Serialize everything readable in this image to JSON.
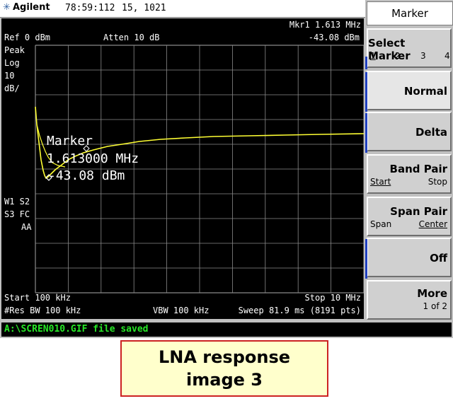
{
  "header": {
    "brand": "Agilent",
    "time": "78:59:112",
    "date": "15, 1021"
  },
  "display": {
    "ref": "Ref 0 dBm",
    "atten": "Atten 10 dB",
    "marker_readout_line1": "Mkr1  1.613 MHz",
    "marker_readout_line2": "-43.08 dBm",
    "detector": "Peak",
    "scale_type": "Log",
    "scale_value": "10",
    "scale_unit": "dB/",
    "trace_flags_1": "W1  S2",
    "trace_flags_2": "S3  FC",
    "trace_flags_3": "AA",
    "marker_label": "Marker",
    "marker_freq": "1.613000 MHz",
    "marker_level": "-43.08 dBm",
    "start_freq": "Start 100 kHz",
    "stop_freq": "Stop 10 MHz",
    "res_bw": "#Res BW 100 kHz",
    "vbw": "VBW 100 kHz",
    "sweep": "Sweep 81.9 ms (8191 pts)",
    "trace_color": "#ffff33",
    "grid_color": "#8a8a8a"
  },
  "softkeys": {
    "menu_title": "Marker",
    "keys": [
      {
        "label": "Select Marker",
        "sub_left": "1",
        "sub_items": [
          "2",
          "3",
          "4"
        ]
      },
      {
        "label": "Normal"
      },
      {
        "label": "Delta"
      },
      {
        "label": "Band Pair",
        "sub_left": "Start",
        "sub_right": "Stop"
      },
      {
        "label": "Span Pair",
        "sub_left": "Span",
        "sub_right": "Center"
      },
      {
        "label": "Off"
      },
      {
        "label": "More",
        "sub_right": "1 of 2"
      }
    ]
  },
  "status": {
    "message": "A:\\SCREN010.GIF file saved"
  },
  "caption": {
    "line1": "LNA response",
    "line2": "image 3"
  }
}
